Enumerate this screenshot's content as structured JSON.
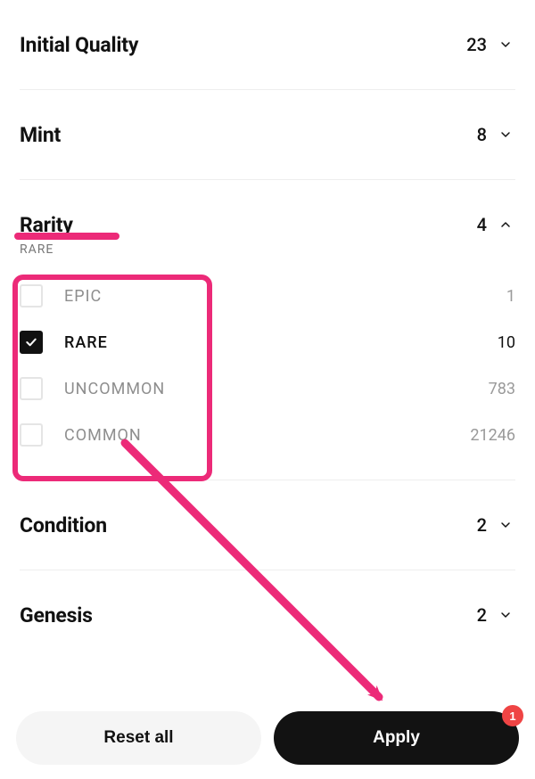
{
  "annotation": {
    "accent": "#ec2a78",
    "badge_color": "#ef4444"
  },
  "sections": {
    "initial_quality": {
      "label": "Initial Quality",
      "count": "23",
      "expanded": false
    },
    "mint": {
      "label": "Mint",
      "count": "8",
      "expanded": false
    },
    "rarity": {
      "label": "Rarity",
      "count": "4",
      "expanded": true,
      "subtitle": "RARE",
      "options": [
        {
          "label": "EPIC",
          "count": "1",
          "checked": false
        },
        {
          "label": "RARE",
          "count": "10",
          "checked": true
        },
        {
          "label": "UNCOMMON",
          "count": "783",
          "checked": false
        },
        {
          "label": "COMMON",
          "count": "21246",
          "checked": false
        }
      ]
    },
    "condition": {
      "label": "Condition",
      "count": "2",
      "expanded": false
    },
    "genesis": {
      "label": "Genesis",
      "count": "2",
      "expanded": false
    }
  },
  "footer": {
    "reset_label": "Reset all",
    "apply_label": "Apply",
    "apply_badge": "1"
  }
}
